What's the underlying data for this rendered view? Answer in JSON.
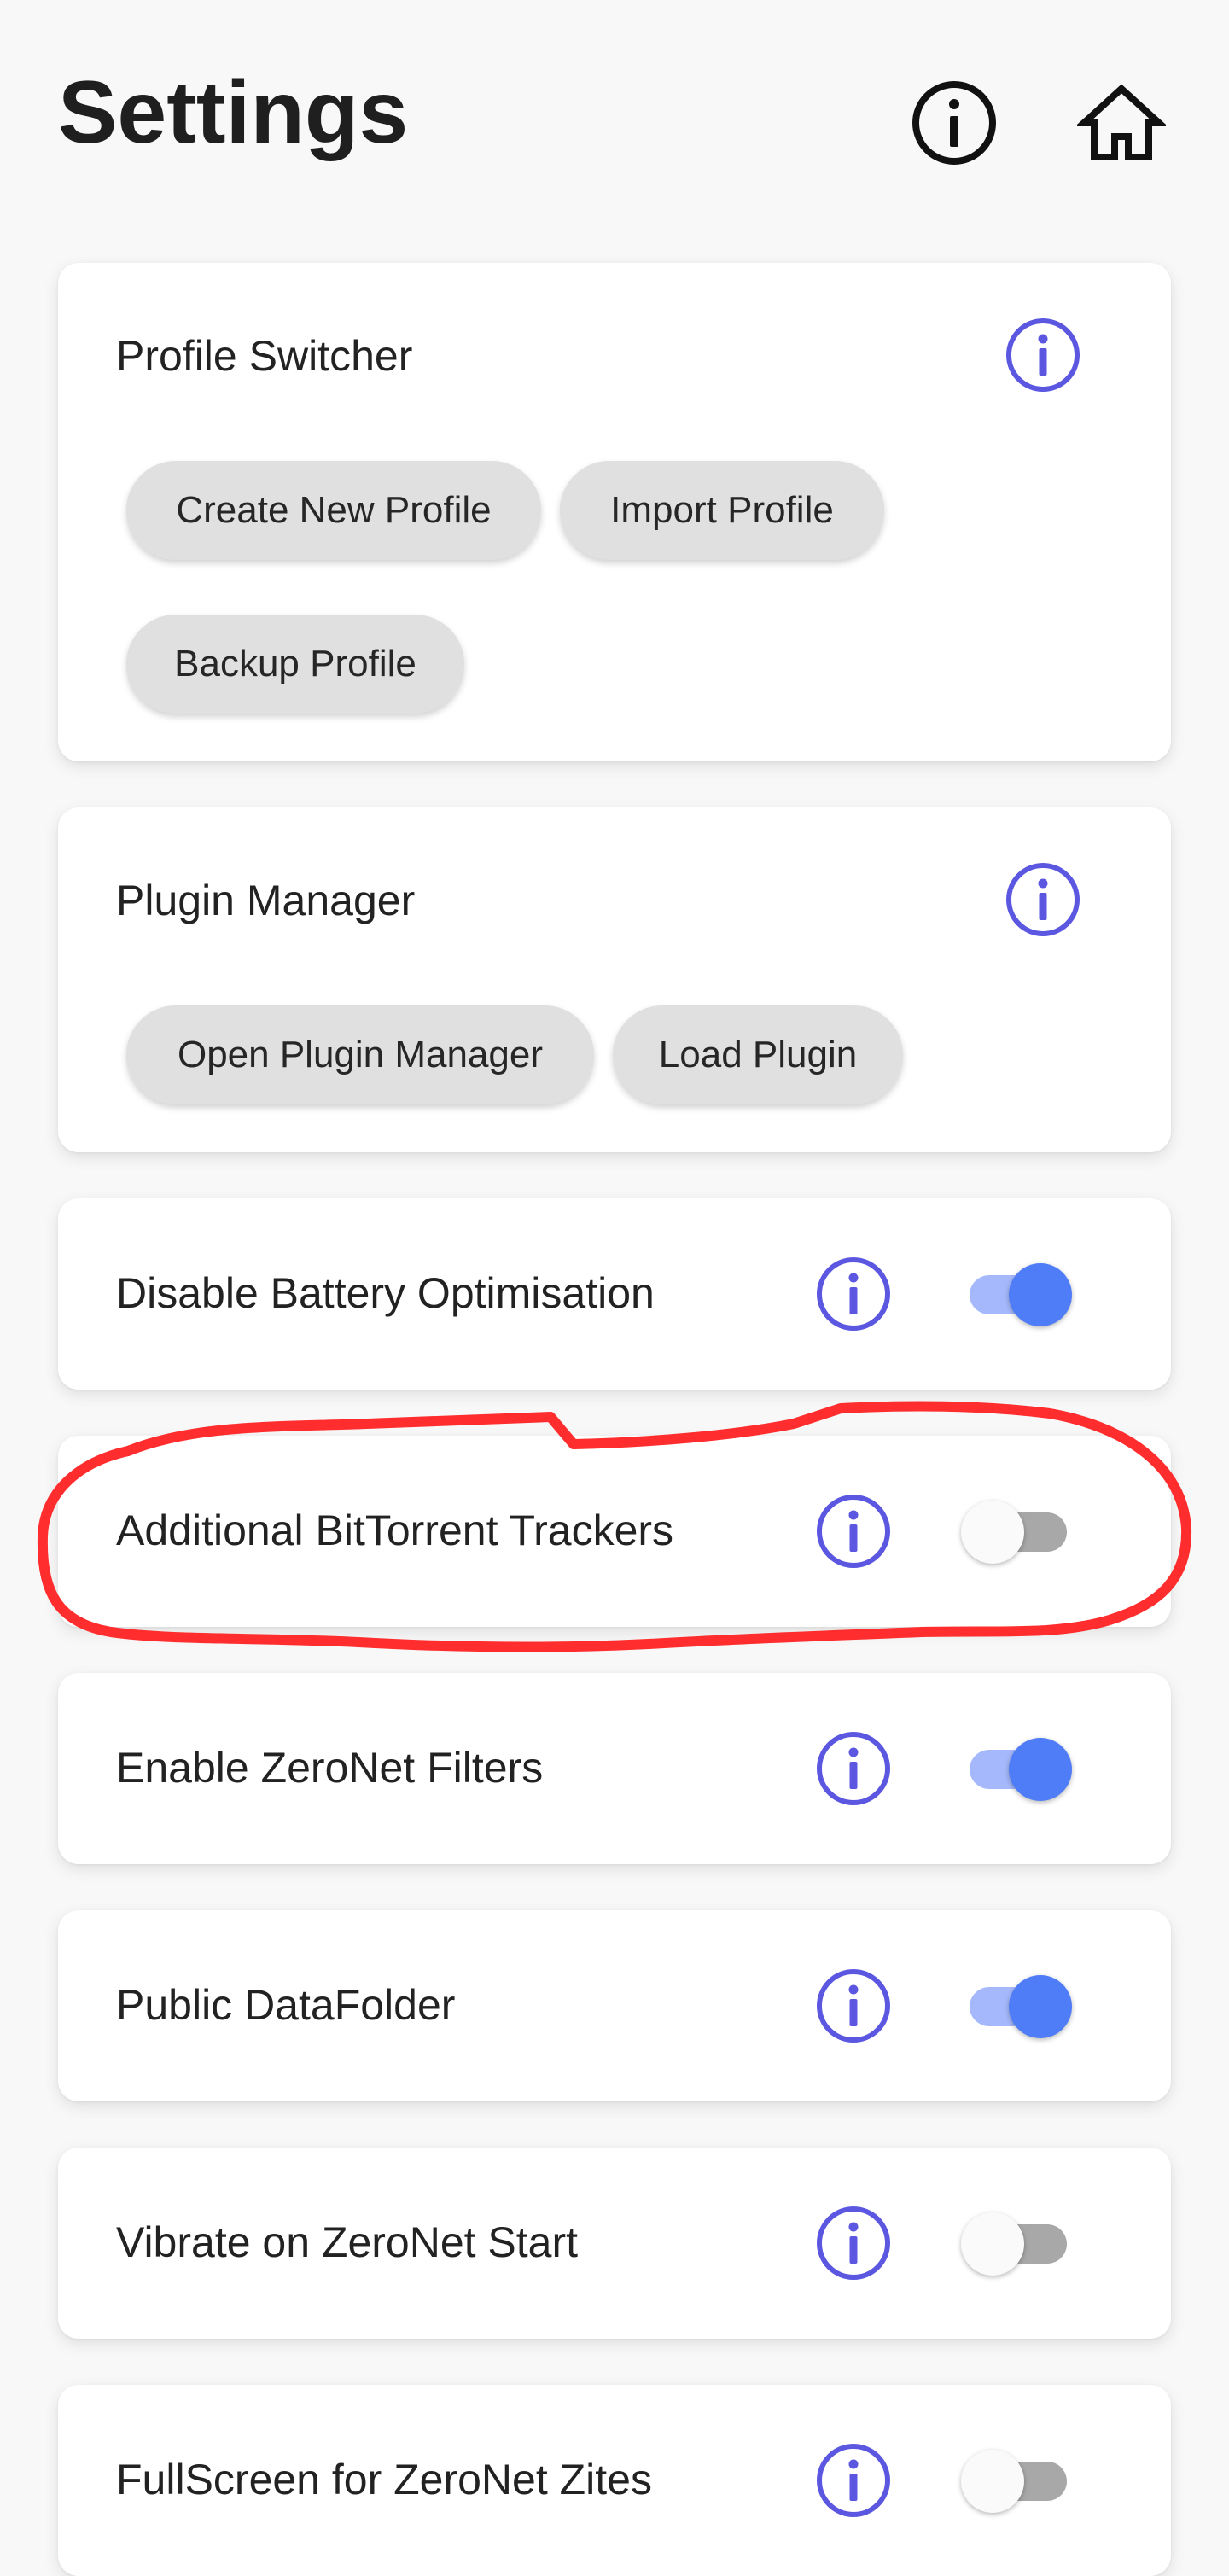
{
  "header": {
    "title": "Settings",
    "info_icon": "info-circle-icon",
    "home_icon": "home-icon"
  },
  "colors": {
    "accent_info": "#5b57e0",
    "switch_on_thumb": "#4f7cf7",
    "switch_on_track": "#a5b8fb",
    "switch_off_thumb": "#fafafa",
    "switch_off_track": "#a8a8a8",
    "annotation": "#ff2d2d",
    "card": "#ffffff",
    "background": "#f8f8f8",
    "chip": "#e0e0e0"
  },
  "profile_switcher": {
    "title": "Profile Switcher",
    "buttons": [
      "Create New Profile",
      "Import Profile",
      "Backup Profile"
    ]
  },
  "plugin_manager": {
    "title": "Plugin Manager",
    "buttons": [
      "Open Plugin Manager",
      "Load Plugin"
    ]
  },
  "toggles": [
    {
      "label": "Disable Battery Optimisation",
      "enabled": true
    },
    {
      "label": "Additional BitTorrent Trackers",
      "enabled": false,
      "annotated": true
    },
    {
      "label": "Enable ZeroNet Filters",
      "enabled": true
    },
    {
      "label": "Public DataFolder",
      "enabled": true
    },
    {
      "label": "Vibrate on ZeroNet Start",
      "enabled": false
    },
    {
      "label": "FullScreen for ZeroNet Zites",
      "enabled": false
    }
  ]
}
